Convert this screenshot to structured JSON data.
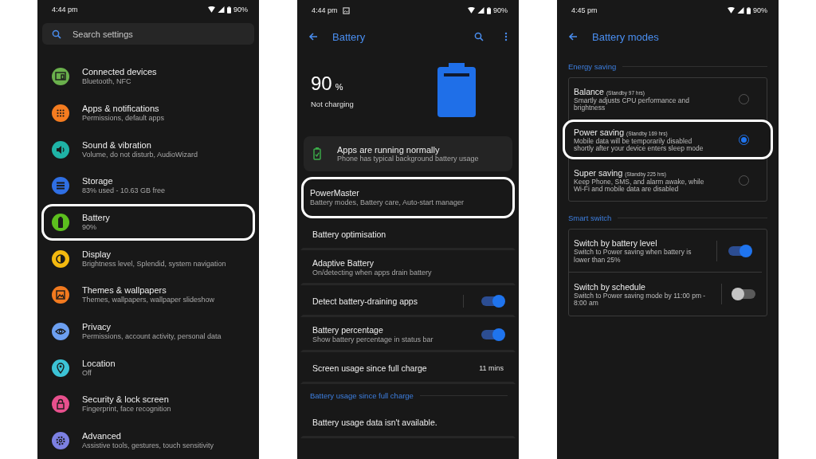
{
  "settings_screen": {
    "status_bar": {
      "time": "4:44 pm",
      "battery": "90%"
    },
    "search": {
      "placeholder": "Search settings"
    },
    "items": [
      {
        "title": "Connected devices",
        "subtitle": "Bluetooth, NFC",
        "color": "#6ab04c",
        "highlighted": false
      },
      {
        "title": "Apps & notifications",
        "subtitle": "Permissions, default apps",
        "color": "#f47c20",
        "highlighted": false
      },
      {
        "title": "Sound & vibration",
        "subtitle": "Volume, do not disturb, AudioWizard",
        "color": "#1fb3a6",
        "highlighted": false
      },
      {
        "title": "Storage",
        "subtitle": "83% used - 10.63 GB free",
        "color": "#2f6fe4",
        "highlighted": false
      },
      {
        "title": "Battery",
        "subtitle": "90%",
        "color": "#5cbf1e",
        "highlighted": true
      },
      {
        "title": "Display",
        "subtitle": "Brightness level, Splendid, system navigation",
        "color": "#f4b90f",
        "highlighted": false
      },
      {
        "title": "Themes & wallpapers",
        "subtitle": "Themes, wallpapers, wallpaper slideshow",
        "color": "#f27a1f",
        "highlighted": false
      },
      {
        "title": "Privacy",
        "subtitle": "Permissions, account activity, personal data",
        "color": "#6c9ff0",
        "highlighted": false
      },
      {
        "title": "Location",
        "subtitle": "Off",
        "color": "#3cc3d6",
        "highlighted": false
      },
      {
        "title": "Security & lock screen",
        "subtitle": "Fingerprint, face recognition",
        "color": "#e8508d",
        "highlighted": false
      },
      {
        "title": "Advanced",
        "subtitle": "Assistive tools, gestures, touch sensitivity",
        "color": "#7c80e2",
        "highlighted": false
      }
    ]
  },
  "battery_screen": {
    "status_bar": {
      "time": "4:44 pm",
      "battery": "90%"
    },
    "title": "Battery",
    "percent": "90",
    "percent_sign": "%",
    "charging_status": "Not charging",
    "status_card": {
      "title": "Apps are running normally",
      "subtitle": "Phone has typical background battery usage"
    },
    "items": [
      {
        "kind": "row",
        "title": "PowerMaster",
        "subtitle": "Battery modes, Battery care, Auto-start manager",
        "highlighted": true
      },
      {
        "kind": "row",
        "title": "Battery optimisation",
        "highlighted": false
      },
      {
        "kind": "row",
        "title": "Adaptive Battery",
        "subtitle": "On/detecting when apps drain battery",
        "highlighted": false
      },
      {
        "kind": "toggle",
        "title": "Detect battery-draining apps",
        "on": true,
        "highlighted": false
      },
      {
        "kind": "toggle",
        "title": "Battery percentage",
        "subtitle": "Show battery percentage in status bar",
        "on": true,
        "highlighted": false
      },
      {
        "kind": "value",
        "title": "Screen usage since full charge",
        "value": "11 mins",
        "highlighted": false
      },
      {
        "kind": "header",
        "title": "Battery usage since full charge"
      },
      {
        "kind": "row",
        "title": "Battery usage data isn't available.",
        "highlighted": false
      }
    ]
  },
  "battery_modes_screen": {
    "status_bar": {
      "time": "4:45 pm",
      "battery": "90%"
    },
    "title": "Battery modes",
    "energy_saving_header": "Energy saving",
    "modes": [
      {
        "name": "Balance",
        "standby": "(Standby 97 hrs)",
        "description": "Smartly adjusts CPU performance and brightness",
        "selected": false,
        "highlighted": false
      },
      {
        "name": "Power saving",
        "standby": "(Standby 169 hrs)",
        "description": "Mobile data will be temporarily disabled shortly after your device enters sleep mode",
        "selected": true,
        "highlighted": true
      },
      {
        "name": "Super saving",
        "standby": "(Standby 225 hrs)",
        "description": "Keep Phone, SMS, and alarm awake, while Wi-Fi and mobile data are disabled",
        "selected": false,
        "highlighted": false
      }
    ],
    "smart_switch_header": "Smart switch",
    "switches": [
      {
        "title": "Switch by battery level",
        "description": "Switch to Power saving when battery is lower than 25%",
        "on": true
      },
      {
        "title": "Switch by schedule",
        "description": "Switch to Power saving mode by 11:00 pm - 8:00 am",
        "on": false
      }
    ]
  }
}
